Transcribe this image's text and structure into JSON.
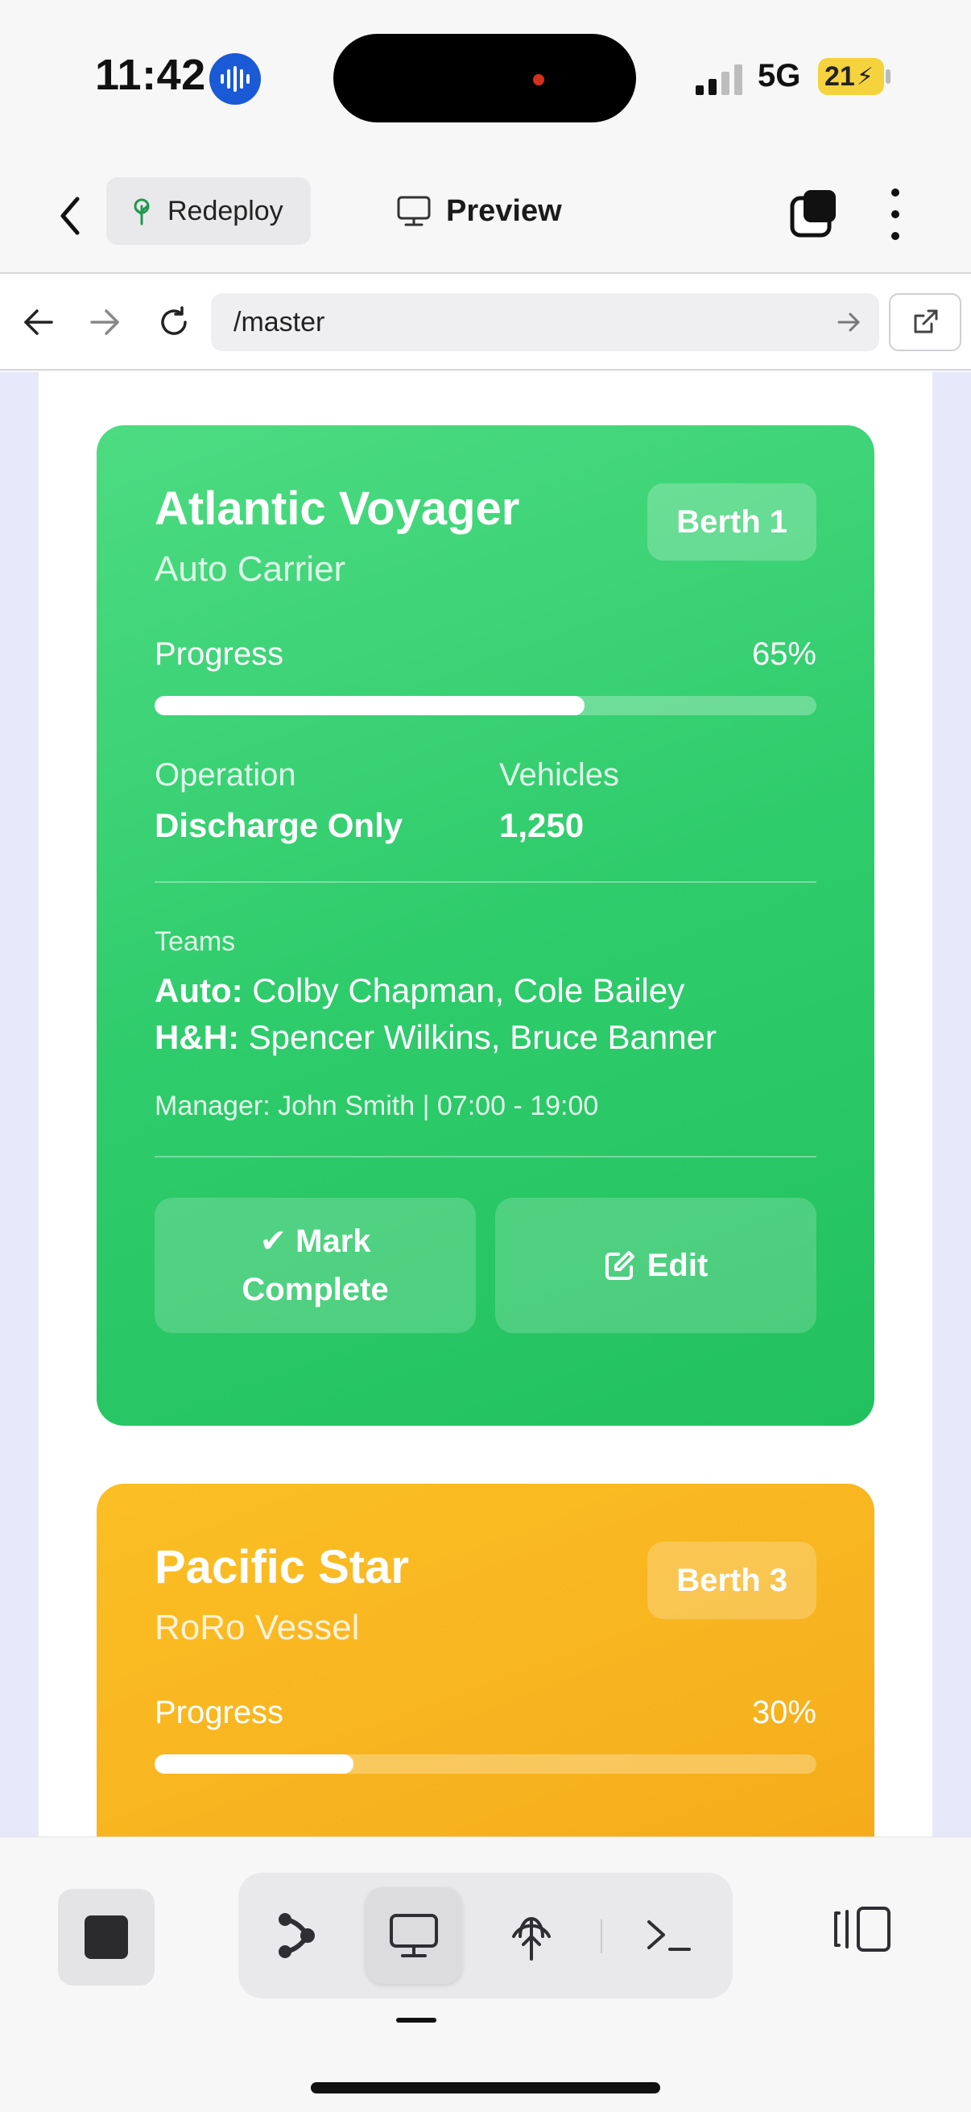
{
  "status_bar": {
    "time": "11:42",
    "network": "5G",
    "battery": "21"
  },
  "header": {
    "redeploy_label": "Redeploy",
    "preview_label": "Preview"
  },
  "url_bar": {
    "path": "/master"
  },
  "ships": [
    {
      "name": "Atlantic Voyager",
      "type": "Auto Carrier",
      "berth": "Berth 1",
      "progress_label": "Progress",
      "progress_text": "65%",
      "progress": 65,
      "operation_label": "Operation",
      "operation": "Discharge Only",
      "vehicles_label": "Vehicles",
      "vehicles": "1,250",
      "teams_label": "Teams",
      "teams": [
        {
          "group": "Auto:",
          "members": "Colby Chapman, Cole Bailey"
        },
        {
          "group": "H&H:",
          "members": "Spencer Wilkins, Bruce Banner"
        }
      ],
      "manager_line": "Manager: John Smith | 07:00 - 19:00",
      "mark_complete_line1": "Mark",
      "mark_complete_line2": "Complete",
      "edit_label": "Edit",
      "color": "#2fcc6c"
    },
    {
      "name": "Pacific Star",
      "type": "RoRo Vessel",
      "berth": "Berth 3",
      "progress_label": "Progress",
      "progress_text": "30%",
      "progress": 30,
      "color": "#f7b21f"
    }
  ],
  "toolbar": {
    "tools": [
      "branch-icon",
      "monitor-icon",
      "deploy-icon",
      "terminal-icon"
    ],
    "active_tool": "monitor-icon"
  }
}
